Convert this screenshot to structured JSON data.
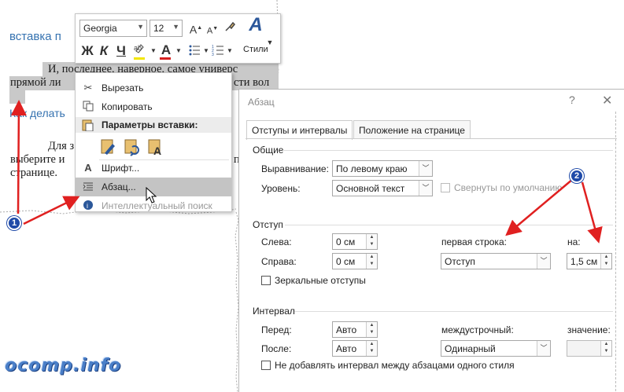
{
  "document": {
    "heading": "вставка п",
    "line1": "И, последнее, наверное, самое универс",
    "line2": "прямой ли",
    "line2b": "сти вол",
    "link": "Как делать",
    "line3": "Для з",
    "line3b": "п",
    "line4": "выберите и",
    "line5": "странице."
  },
  "minibar": {
    "font_name": "Georgia",
    "font_size": "12",
    "styles_label": "Стили",
    "bold_glyph": "Ж",
    "italic_glyph": "К",
    "underline_glyph": "Ч",
    "font_color_glyph": "А",
    "grow_glyph": "А",
    "shrink_glyph": "А",
    "styles_glyph": "A",
    "highlight_color": "#f2e600",
    "font_color": "#d62020"
  },
  "context_menu": {
    "cut": "Вырезать",
    "copy": "Копировать",
    "paste_header": "Параметры вставки:",
    "font": "Шрифт...",
    "paragraph": "Абзац...",
    "smart_lookup": "Интеллектуальный поиск"
  },
  "dialog": {
    "title": "Абзац",
    "help": "?",
    "close": "✕",
    "tabs": [
      "Отступы и интервалы",
      "Положение на странице"
    ],
    "general": {
      "section": "Общие",
      "alignment_label": "Выравнивание:",
      "alignment_value": "По левому краю",
      "level_label": "Уровень:",
      "level_value": "Основной текст",
      "collapsed_label": "Свернуты по умолчанию"
    },
    "indent": {
      "section": "Отступ",
      "left_label": "Слева:",
      "left_value": "0 см",
      "right_label": "Справа:",
      "right_value": "0 см",
      "first_line_label": "первая строка:",
      "first_line_value": "Отступ",
      "by_label": "на:",
      "by_value": "1,5 см",
      "mirror_label": "Зеркальные отступы"
    },
    "spacing": {
      "section": "Интервал",
      "before_label": "Перед:",
      "before_value": "Авто",
      "after_label": "После:",
      "after_value": "Авто",
      "line_label": "междустрочный:",
      "line_value": "Одинарный",
      "at_label": "значение:",
      "at_value": "",
      "no_space_label": "Не добавлять интервал между абзацами одного стиля"
    }
  },
  "annotations": {
    "badge1": "1",
    "badge2": "2",
    "arrow_color": "#e02020",
    "badge_color": "#1f4aa8",
    "watermark": "ocomp.info"
  }
}
